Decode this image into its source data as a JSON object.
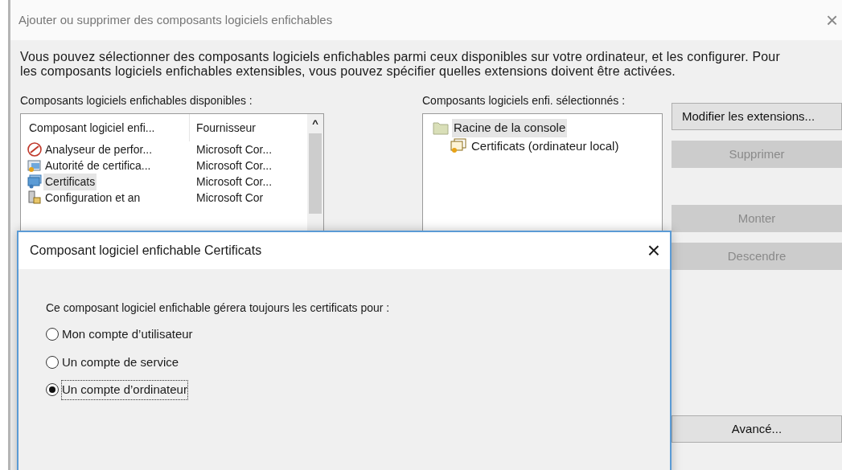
{
  "window": {
    "title": "Ajouter ou supprimer des composants logiciels enfichables",
    "close": "×"
  },
  "intro": "Vous pouvez sélectionner des composants logiciels enfichables parmi ceux disponibles sur votre ordinateur, et les configurer. Pour les composants logiciels enfichables extensibles, vous pouvez spécifier quelles extensions doivent être activées.",
  "available": {
    "label": "Composants logiciels enfichables disponibles :",
    "columns": [
      "Composant logiciel enfi...",
      "Fournisseur"
    ],
    "scroll_up": "^",
    "rows": [
      {
        "kind": "performance",
        "name": "Analyseur de perfor...",
        "vendor": "Microsoft Cor...",
        "selected": false
      },
      {
        "kind": "authority",
        "name": "Autorité de certifica...",
        "vendor": "Microsoft Cor...",
        "selected": false
      },
      {
        "kind": "certificates",
        "name": "Certificats",
        "vendor": "Microsoft Cor...",
        "selected": true
      },
      {
        "kind": "server",
        "name": "Configuration et an",
        "vendor": "Microsoft Cor",
        "selected": false
      }
    ]
  },
  "selected_list": {
    "label": "Composants logiciels enfi. sélectionnés :",
    "tree": [
      {
        "kind": "folder",
        "label": "Racine de la console",
        "selected": true,
        "children": [
          {
            "kind": "certificate",
            "label": "Certificats (ordinateur local)",
            "selected": false
          }
        ]
      }
    ]
  },
  "button_groups": [
    [
      {
        "label": "Modifier les extensions...",
        "disabled": false
      },
      {
        "label": "Supprimer",
        "disabled": true
      }
    ],
    [
      {
        "label": "Monter",
        "disabled": true
      },
      {
        "label": "Descendre",
        "disabled": true
      }
    ],
    [
      {
        "label": "Avancé...",
        "disabled": false
      }
    ]
  ],
  "dialog": {
    "title": "Composant logiciel enfichable Certificats",
    "close": "×",
    "prompt": "Ce composant logiciel enfichable gérera toujours les certificats pour :",
    "options": [
      {
        "label": "Mon compte d’utilisateur",
        "selected": false
      },
      {
        "label": "Un compte de service",
        "selected": false
      },
      {
        "label": "Un compte d’ordinateur",
        "selected": true
      }
    ]
  }
}
